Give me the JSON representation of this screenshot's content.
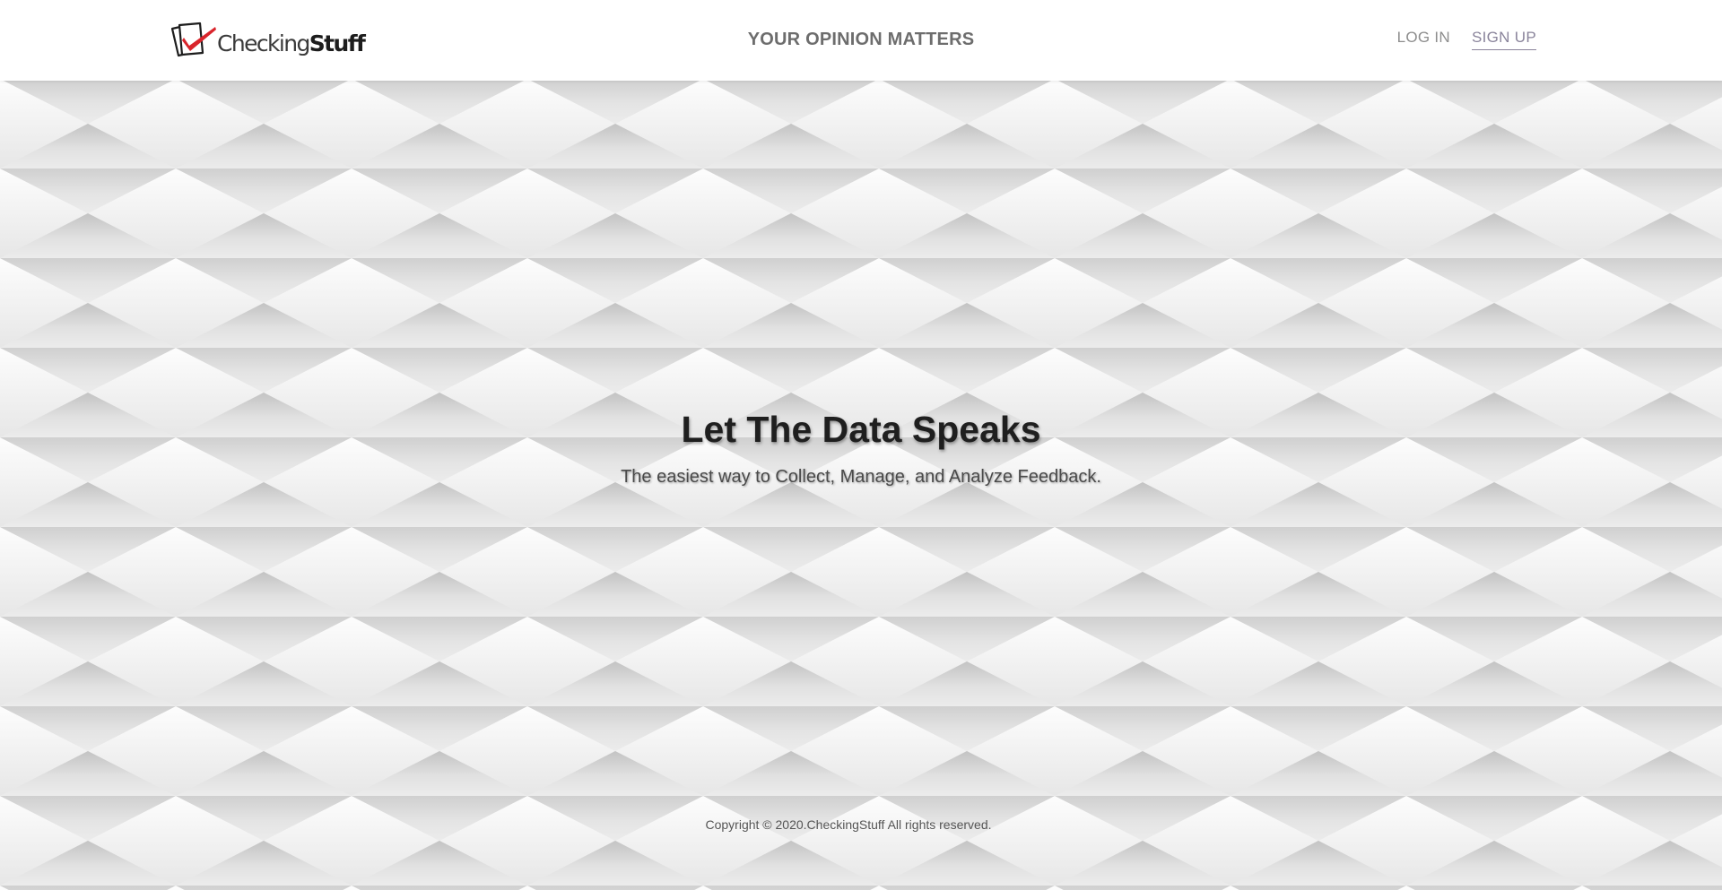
{
  "header": {
    "logo": {
      "word_light": "Checking",
      "word_bold": "Stuff",
      "icon": "checkmark-cards-icon",
      "accent_color": "#d9242b"
    },
    "tagline": "YOUR OPINION MATTERS",
    "nav": {
      "login_label": "LOG IN",
      "signup_label": "SIGN UP"
    }
  },
  "hero": {
    "title": "Let The Data Speaks",
    "subtitle": "The easiest way to Collect, Manage, and Analyze Feedback."
  },
  "footer": {
    "copyright": "Copyright © 2020.CheckingStuff All rights reserved."
  }
}
